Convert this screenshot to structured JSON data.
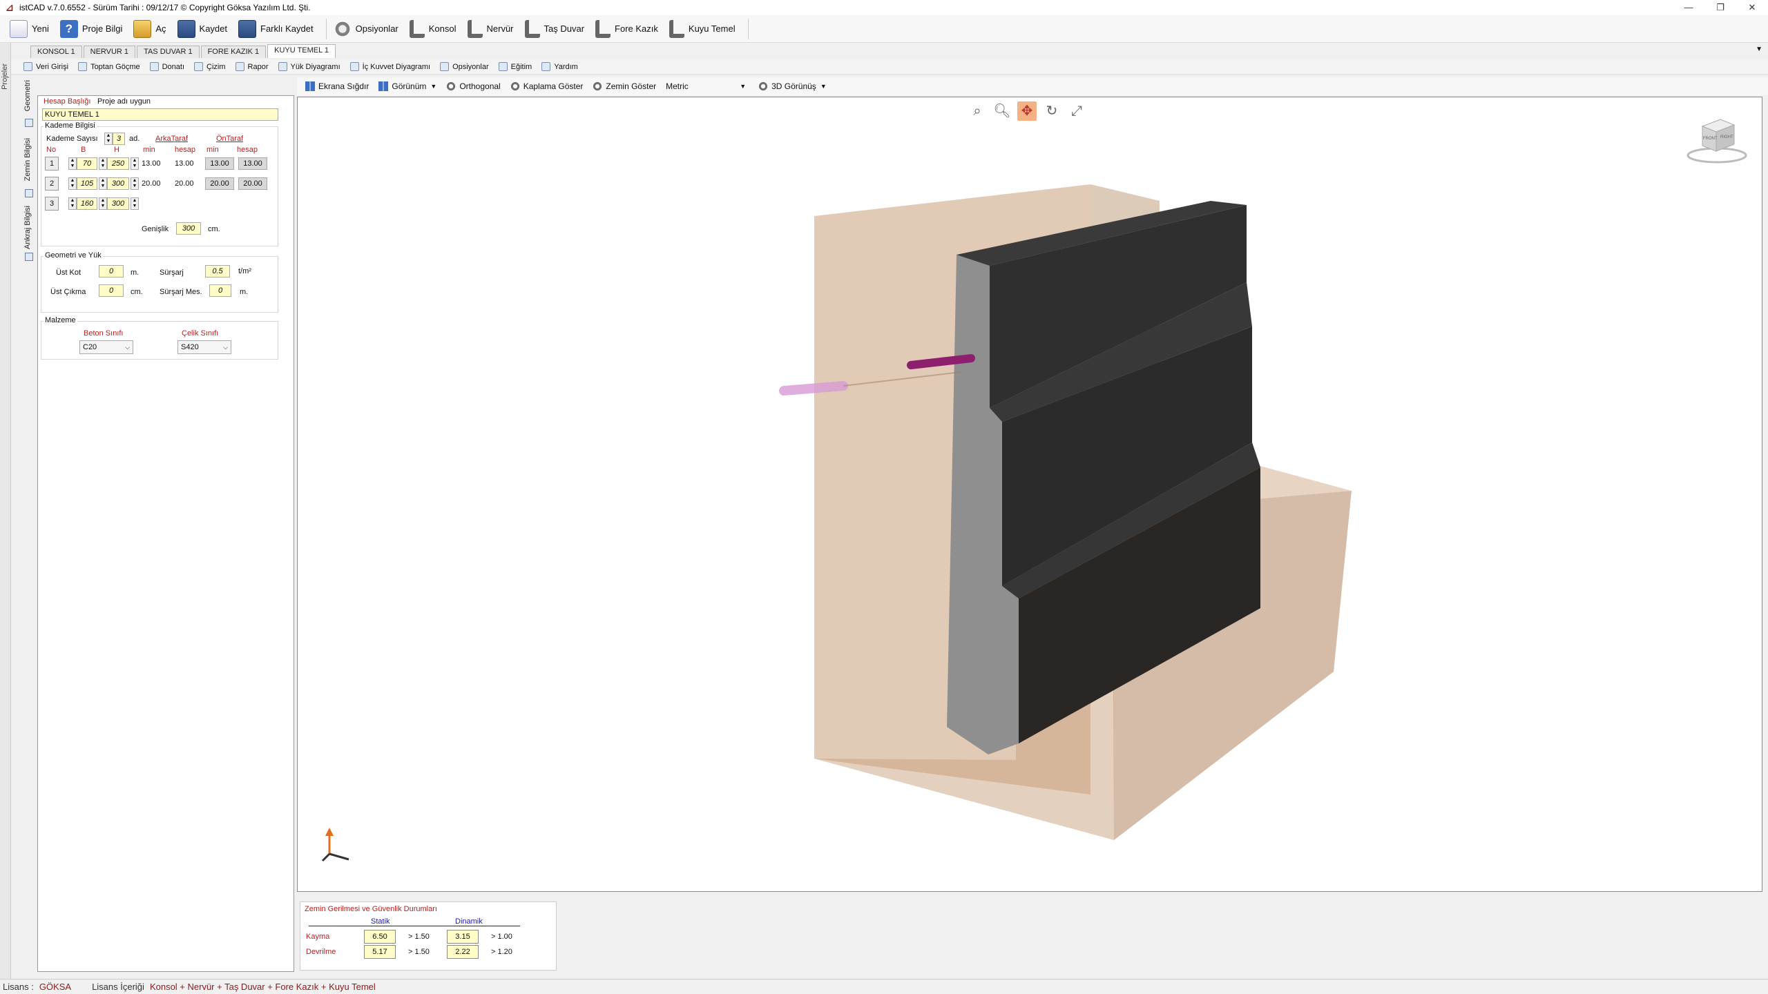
{
  "window": {
    "title": "istCAD v.7.0.6552 -  Sürüm Tarihi : 09/12/17  © Copyright Göksa Yazılım Ltd. Şti.",
    "minimize": "—",
    "maximize": "❐",
    "close": "✕"
  },
  "toolbar": {
    "new": "Yeni",
    "project_info": "Proje Bilgi",
    "open": "Aç",
    "save": "Kaydet",
    "save_as": "Farklı Kaydet",
    "options": "Opsiyonlar",
    "konsol": "Konsol",
    "nervur": "Nervür",
    "tas_duvar": "Taş Duvar",
    "fore_kazik": "Fore Kazık",
    "kuyu_temel": "Kuyu Temel"
  },
  "left_strip": {
    "label": "Projeler"
  },
  "doc_tabs": [
    "KONSOL 1",
    "NERVUR 1",
    "TAS DUVAR 1",
    "FORE KAZIK 1",
    "KUYU TEMEL 1"
  ],
  "doc_tabs_arrow": "▼",
  "subtoolbar": {
    "veri_girisi": "Veri Girişi",
    "toptan_gocme": "Toptan Göçme",
    "donati": "Donatı",
    "cizim": "Çizim",
    "rapor": "Rapor",
    "yuk_diyagrami": "Yük Diyagramı",
    "ic_kuvvet": "İç Kuvvet Diyagramı",
    "opsiyonlar": "Opsiyonlar",
    "egitim": "Eğitim",
    "yardim": "Yardım"
  },
  "side_tabs": {
    "geometri": "Geometri",
    "zemin_bilgisi": "Zemin Bilgisi",
    "ankraj_bilgisi": "Ankraj Bilgisi"
  },
  "left_panel": {
    "hesap_basligi_label": "Hesap Başlığı",
    "hesap_basligi_hint": "Proje adı uygun",
    "hesap_basligi_value": "KUYU TEMEL 1",
    "kademe_bilgisi": "Kademe Bilgisi",
    "kademe_sayisi_label": "Kademe Sayısı",
    "kademe_sayisi_value": "3",
    "kademe_unit": "ad.",
    "arka_taraf": "ArkaTaraf",
    "on_taraf": "ÖnTaraf",
    "col_no": "No",
    "col_b": "B",
    "col_h": "H",
    "col_min1": "min",
    "col_hesap1": "hesap",
    "col_min2": "min",
    "col_hesap2": "hesap",
    "rows": [
      {
        "no": "1",
        "b": "70",
        "h": "250",
        "arka_min": "13.00",
        "arka_hesap": "13.00",
        "on_min": "13.00",
        "on_hesap": "13.00"
      },
      {
        "no": "2",
        "b": "105",
        "h": "300",
        "arka_min": "20.00",
        "arka_hesap": "20.00",
        "on_min": "20.00",
        "on_hesap": "20.00"
      },
      {
        "no": "3",
        "b": "160",
        "h": "300"
      }
    ],
    "genislik_label": "Genişlik",
    "genislik_value": "300",
    "genislik_unit": "cm.",
    "geometri_yuk": "Geometri ve Yük",
    "ust_kot_label": "Üst Kot",
    "ust_kot_value": "0",
    "ust_kot_unit": "m.",
    "sursarj_label": "Sürşarj",
    "sursarj_value": "0.5",
    "sursarj_unit": "t/m²",
    "ust_cikma_label": "Üst Çıkma",
    "ust_cikma_value": "0",
    "ust_cikma_unit": "cm.",
    "sursarj_mes_label": "Sürşarj Mes.",
    "sursarj_mes_value": "0",
    "sursarj_mes_unit": "m.",
    "malzeme": "Malzeme",
    "beton_sinifi_label": "Beton Sınıfı",
    "celik_sinifi_label": "Çelik Sınıfı",
    "beton_sinifi_value": "C20",
    "celik_sinifi_value": "S420"
  },
  "viewport_toolbar": {
    "ekrana_sigdir": "Ekrana Sığdır",
    "gorunum": "Görünüm",
    "orthogonal": "Orthogonal",
    "kaplama_goster": "Kaplama Göster",
    "zemin_goster": "Zemin Göster",
    "units_value": "Metric",
    "gorunus_3d": "3D Görünüş"
  },
  "viewcube": {
    "front": "FRONT",
    "right": "RIGHT"
  },
  "results": {
    "title": "Zemin Gerilmesi ve Güvenlik Durumları",
    "statik": "Statik",
    "dinamik": "Dinamik",
    "kayma_label": "Kayma",
    "kayma_statik": "6.50",
    "kayma_statik_limit": "> 1.50",
    "kayma_dinamik": "3.15",
    "kayma_dinamik_limit": "> 1.00",
    "devrilme_label": "Devrilme",
    "devrilme_statik": "5.17",
    "devrilme_statik_limit": "> 1.50",
    "devrilme_dinamik": "2.22",
    "devrilme_dinamik_limit": "> 1.20"
  },
  "statusbar": {
    "lisans_label": "Lisans :",
    "lisans_value": "GÖKSA",
    "icerik_label": "Lisans İçeriği",
    "icerik_value": "Konsol + Nervür + Taş Duvar + Fore Kazık + Kuyu Temel"
  },
  "colors": {
    "accent_red": "#b22222",
    "soil": "#c8a07a",
    "concrete_dark": "#2e2e2e",
    "concrete_side": "#8a8a8a"
  }
}
